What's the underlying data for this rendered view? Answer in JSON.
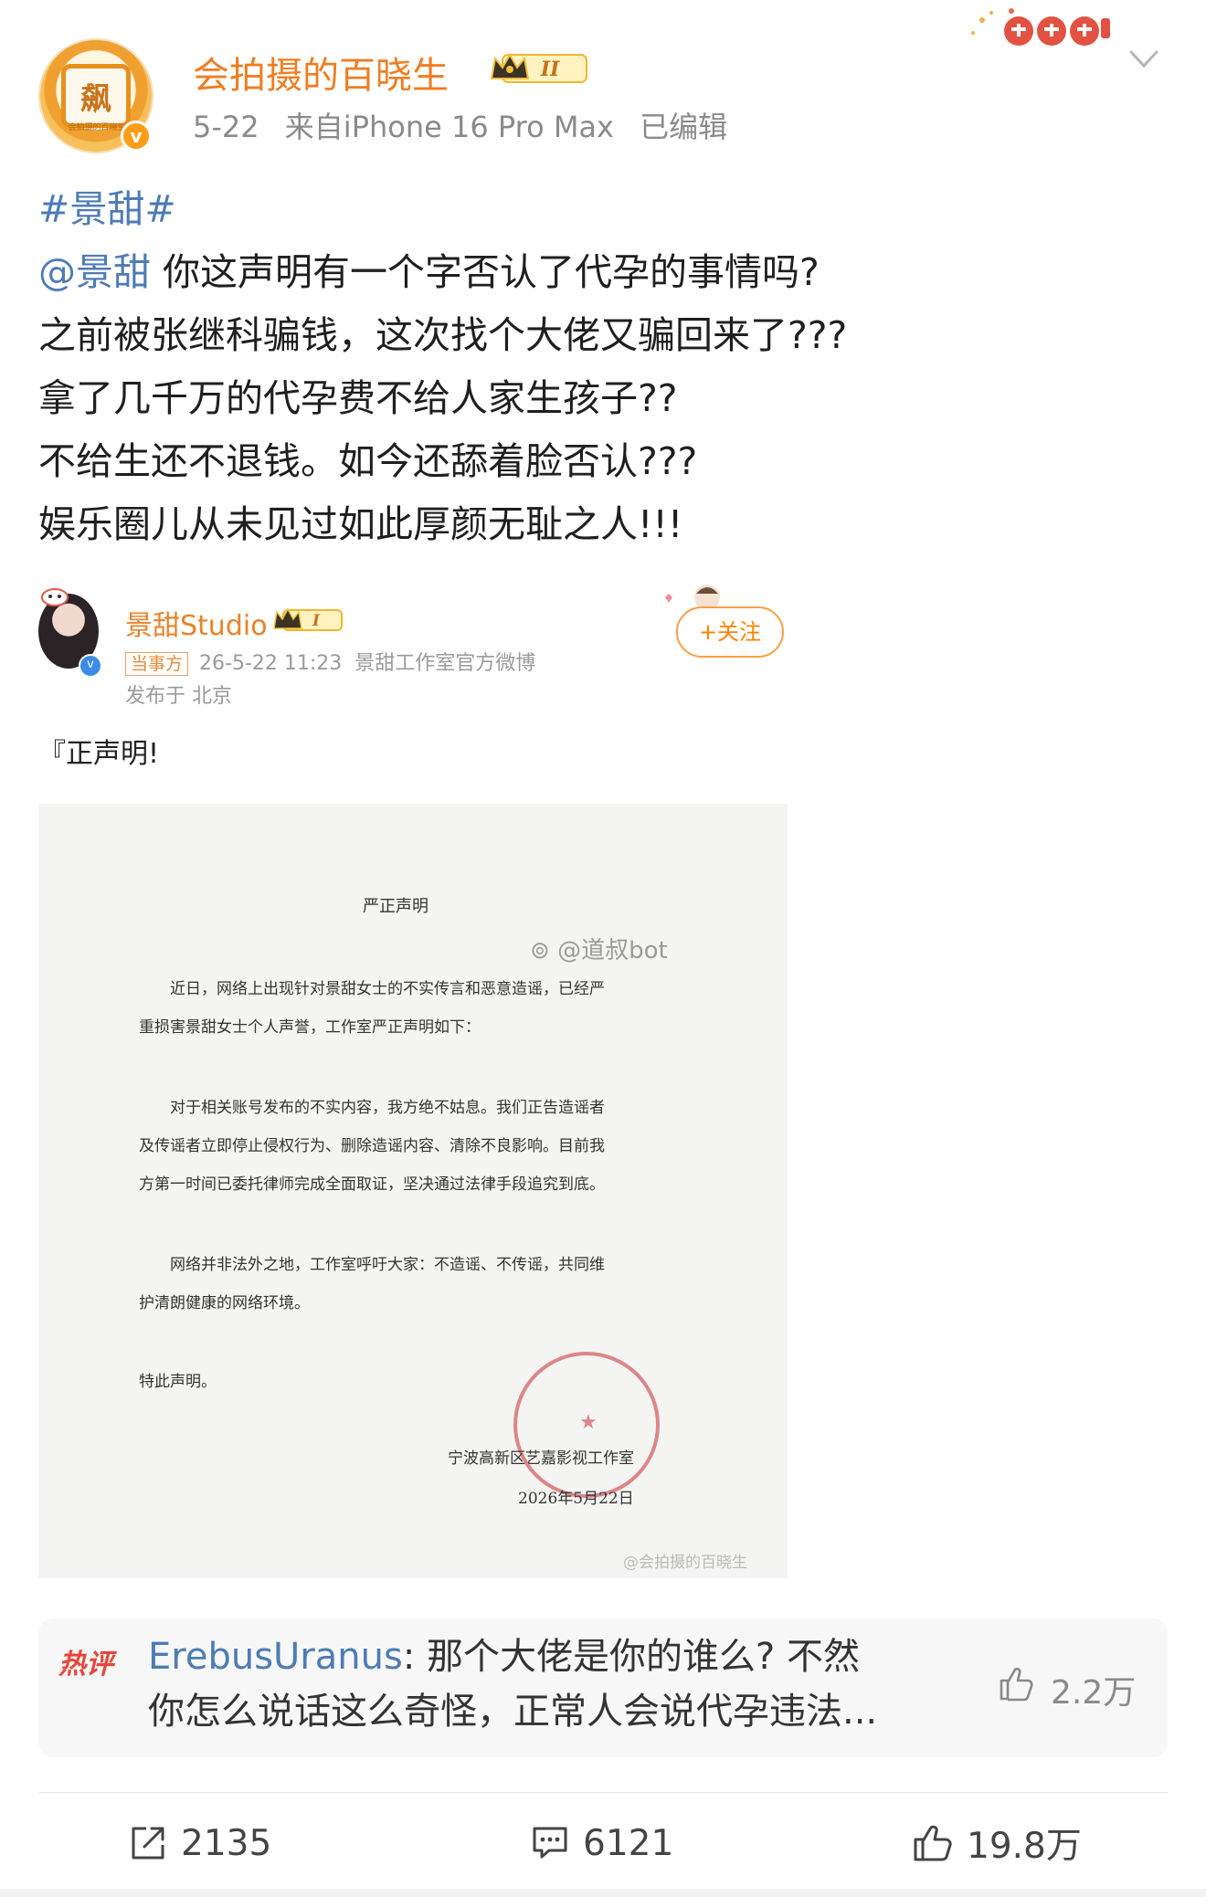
{
  "post": {
    "username": "会拍摄的百晓生",
    "level_badge": "II",
    "date": "5-22",
    "source": "来自iPhone 16 Pro Max",
    "edited": "已编辑",
    "avatar_caption": "会拍摄的百晓生",
    "avatar_glyph": "飙",
    "hashtag": "#景甜#",
    "mention": "@景甜",
    "lines": [
      "你这声明有一个字否认了代孕的事情吗?",
      "之前被张继科骗钱，这次找个大佬又骗回来了???",
      "拿了几千万的代孕费不给人家生孩子??",
      "不给生还不退钱。如今还舔着脸否认???",
      "娱乐圈儿从未见过如此厚颜无耻之人!!!"
    ]
  },
  "quoted": {
    "name": "景甜Studio",
    "level_badge": "I",
    "tag": "当事方",
    "datetime": "26-5-22 11:23",
    "desc": "景甜工作室官方微博",
    "location": "发布于 北京",
    "follow_label": "+关注",
    "statement": "『正声明!"
  },
  "document": {
    "title": "严正声明",
    "watermark": "@道叔bot",
    "paragraphs": [
      [
        "近日，网络上出现针对景甜女士的不实传言和恶意造谣，已经严",
        "重损害景甜女士个人声誉，工作室严正声明如下："
      ],
      [
        "对于相关账号发布的不实内容，我方绝不姑息。我们正告造谣者",
        "及传谣者立即停止侵权行为、删除造谣内容、清除不良影响。目前我",
        "方第一时间已委托律师完成全面取证，坚决通过法律手段追究到底。"
      ],
      [
        "网络并非法外之地，工作室呼吁大家：不造谣、不传谣，共同维",
        "护清朗健康的网络环境。"
      ]
    ],
    "closing": "特此声明。",
    "signer": "宁波高新区艺嘉影视工作室",
    "sign_date": "2026年5月22日",
    "bottom_watermark": "@会拍摄的百晓生"
  },
  "hot_comment": {
    "tag": "热评",
    "user": "ErebusUranus",
    "text_line1": ": 那个大佬是你的谁么? 不然",
    "text_line2": "你怎么说话这么奇怪，正常人会说代孕违法...",
    "likes": "2.2万"
  },
  "actions": {
    "share_count": "2135",
    "comment_count": "6121",
    "like_count": "19.8万"
  },
  "colors": {
    "username": "#ef7d22",
    "link": "#4d7bb5",
    "hot_tag": "#e8463a"
  },
  "icons": [
    "chevron-down-icon",
    "crown-badge-icon",
    "share-icon",
    "comment-icon",
    "like-icon",
    "verified-icon",
    "follow-icon"
  ]
}
